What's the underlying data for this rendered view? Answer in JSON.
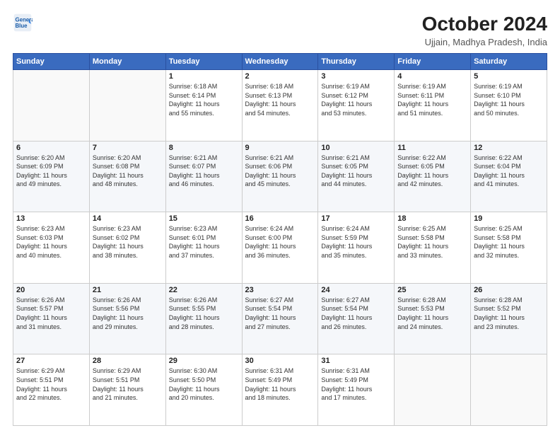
{
  "header": {
    "logo_line1": "General",
    "logo_line2": "Blue",
    "main_title": "October 2024",
    "sub_title": "Ujjain, Madhya Pradesh, India"
  },
  "weekdays": [
    "Sunday",
    "Monday",
    "Tuesday",
    "Wednesday",
    "Thursday",
    "Friday",
    "Saturday"
  ],
  "weeks": [
    [
      {
        "day": "",
        "detail": ""
      },
      {
        "day": "",
        "detail": ""
      },
      {
        "day": "1",
        "detail": "Sunrise: 6:18 AM\nSunset: 6:14 PM\nDaylight: 11 hours\nand 55 minutes."
      },
      {
        "day": "2",
        "detail": "Sunrise: 6:18 AM\nSunset: 6:13 PM\nDaylight: 11 hours\nand 54 minutes."
      },
      {
        "day": "3",
        "detail": "Sunrise: 6:19 AM\nSunset: 6:12 PM\nDaylight: 11 hours\nand 53 minutes."
      },
      {
        "day": "4",
        "detail": "Sunrise: 6:19 AM\nSunset: 6:11 PM\nDaylight: 11 hours\nand 51 minutes."
      },
      {
        "day": "5",
        "detail": "Sunrise: 6:19 AM\nSunset: 6:10 PM\nDaylight: 11 hours\nand 50 minutes."
      }
    ],
    [
      {
        "day": "6",
        "detail": "Sunrise: 6:20 AM\nSunset: 6:09 PM\nDaylight: 11 hours\nand 49 minutes."
      },
      {
        "day": "7",
        "detail": "Sunrise: 6:20 AM\nSunset: 6:08 PM\nDaylight: 11 hours\nand 48 minutes."
      },
      {
        "day": "8",
        "detail": "Sunrise: 6:21 AM\nSunset: 6:07 PM\nDaylight: 11 hours\nand 46 minutes."
      },
      {
        "day": "9",
        "detail": "Sunrise: 6:21 AM\nSunset: 6:06 PM\nDaylight: 11 hours\nand 45 minutes."
      },
      {
        "day": "10",
        "detail": "Sunrise: 6:21 AM\nSunset: 6:05 PM\nDaylight: 11 hours\nand 44 minutes."
      },
      {
        "day": "11",
        "detail": "Sunrise: 6:22 AM\nSunset: 6:05 PM\nDaylight: 11 hours\nand 42 minutes."
      },
      {
        "day": "12",
        "detail": "Sunrise: 6:22 AM\nSunset: 6:04 PM\nDaylight: 11 hours\nand 41 minutes."
      }
    ],
    [
      {
        "day": "13",
        "detail": "Sunrise: 6:23 AM\nSunset: 6:03 PM\nDaylight: 11 hours\nand 40 minutes."
      },
      {
        "day": "14",
        "detail": "Sunrise: 6:23 AM\nSunset: 6:02 PM\nDaylight: 11 hours\nand 38 minutes."
      },
      {
        "day": "15",
        "detail": "Sunrise: 6:23 AM\nSunset: 6:01 PM\nDaylight: 11 hours\nand 37 minutes."
      },
      {
        "day": "16",
        "detail": "Sunrise: 6:24 AM\nSunset: 6:00 PM\nDaylight: 11 hours\nand 36 minutes."
      },
      {
        "day": "17",
        "detail": "Sunrise: 6:24 AM\nSunset: 5:59 PM\nDaylight: 11 hours\nand 35 minutes."
      },
      {
        "day": "18",
        "detail": "Sunrise: 6:25 AM\nSunset: 5:58 PM\nDaylight: 11 hours\nand 33 minutes."
      },
      {
        "day": "19",
        "detail": "Sunrise: 6:25 AM\nSunset: 5:58 PM\nDaylight: 11 hours\nand 32 minutes."
      }
    ],
    [
      {
        "day": "20",
        "detail": "Sunrise: 6:26 AM\nSunset: 5:57 PM\nDaylight: 11 hours\nand 31 minutes."
      },
      {
        "day": "21",
        "detail": "Sunrise: 6:26 AM\nSunset: 5:56 PM\nDaylight: 11 hours\nand 29 minutes."
      },
      {
        "day": "22",
        "detail": "Sunrise: 6:26 AM\nSunset: 5:55 PM\nDaylight: 11 hours\nand 28 minutes."
      },
      {
        "day": "23",
        "detail": "Sunrise: 6:27 AM\nSunset: 5:54 PM\nDaylight: 11 hours\nand 27 minutes."
      },
      {
        "day": "24",
        "detail": "Sunrise: 6:27 AM\nSunset: 5:54 PM\nDaylight: 11 hours\nand 26 minutes."
      },
      {
        "day": "25",
        "detail": "Sunrise: 6:28 AM\nSunset: 5:53 PM\nDaylight: 11 hours\nand 24 minutes."
      },
      {
        "day": "26",
        "detail": "Sunrise: 6:28 AM\nSunset: 5:52 PM\nDaylight: 11 hours\nand 23 minutes."
      }
    ],
    [
      {
        "day": "27",
        "detail": "Sunrise: 6:29 AM\nSunset: 5:51 PM\nDaylight: 11 hours\nand 22 minutes."
      },
      {
        "day": "28",
        "detail": "Sunrise: 6:29 AM\nSunset: 5:51 PM\nDaylight: 11 hours\nand 21 minutes."
      },
      {
        "day": "29",
        "detail": "Sunrise: 6:30 AM\nSunset: 5:50 PM\nDaylight: 11 hours\nand 20 minutes."
      },
      {
        "day": "30",
        "detail": "Sunrise: 6:31 AM\nSunset: 5:49 PM\nDaylight: 11 hours\nand 18 minutes."
      },
      {
        "day": "31",
        "detail": "Sunrise: 6:31 AM\nSunset: 5:49 PM\nDaylight: 11 hours\nand 17 minutes."
      },
      {
        "day": "",
        "detail": ""
      },
      {
        "day": "",
        "detail": ""
      }
    ]
  ]
}
